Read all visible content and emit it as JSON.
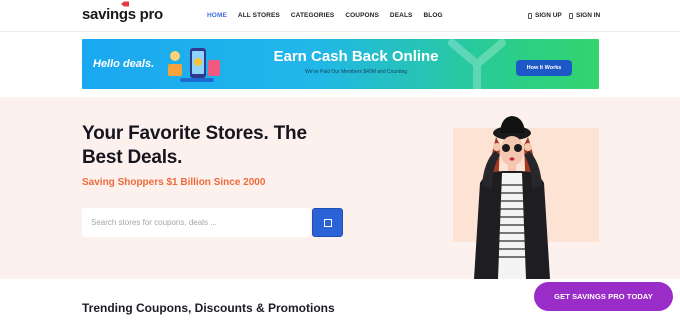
{
  "header": {
    "logo": "savings pro",
    "nav": [
      "HOME",
      "ALL STORES",
      "CATEGORIES",
      "COUPONS",
      "DEALS",
      "BLOG"
    ],
    "active_nav": "HOME",
    "sign_up": "SIGN UP",
    "sign_in": "SIGN IN"
  },
  "banner": {
    "hello": "Hello deals.",
    "title": "Earn Cash Back Online",
    "subtitle": "We've Paid Our Members $40M and Counting",
    "button": "How It Works"
  },
  "hero": {
    "headline": "Your Favorite Stores. The Best Deals.",
    "tagline": "Saving Shoppers $1 Billion Since 2000",
    "search_placeholder": "Search stores for coupons, deals ..."
  },
  "section": {
    "trending_title": "Trending Coupons, Discounts & Promotions"
  },
  "cta": {
    "label": "GET SAVINGS PRO TODAY"
  },
  "colors": {
    "accent_blue": "#2b63d6",
    "tagline_orange": "#ef6a3b",
    "cta_purple": "#9a2dc7",
    "hero_bg": "#fdf1ee"
  }
}
